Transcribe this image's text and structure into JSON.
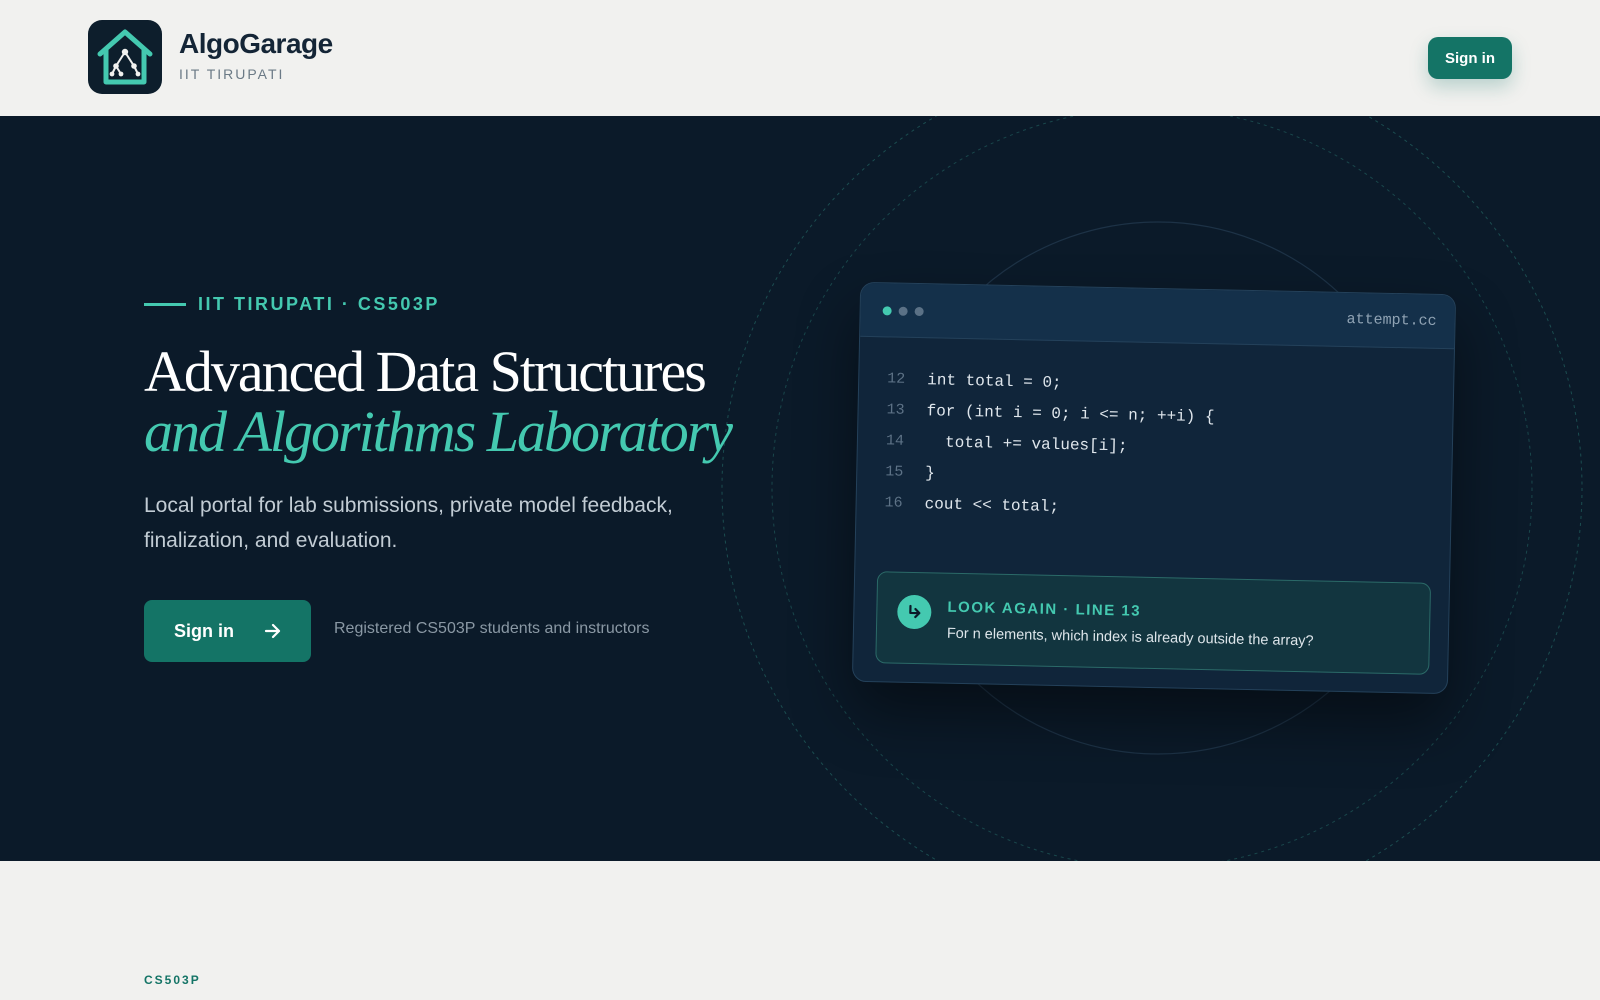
{
  "header": {
    "brand_name": "AlgoGarage",
    "brand_sub": "IIT TIRUPATI",
    "signin_label": "Sign in",
    "logo_icon": "house-tree-icon"
  },
  "hero": {
    "eyebrow": "IIT TIRUPATI · CS503P",
    "title_line1": "Advanced Data Structures",
    "title_line2": "and Algorithms Laboratory",
    "description": "Local portal for lab submissions, private model feedback, finalization, and evaluation.",
    "signin_label": "Sign in",
    "signin_icon": "arrow-right-icon",
    "note": "Registered CS503P students and instructors"
  },
  "code_card": {
    "filename": "attempt.cc",
    "lines": [
      {
        "num": "12",
        "text": "int total = 0;"
      },
      {
        "num": "13",
        "text": "for (int i = 0; i <= n; ++i) {"
      },
      {
        "num": "14",
        "text": "  total += values[i];"
      },
      {
        "num": "15",
        "text": "}"
      },
      {
        "num": "16",
        "text": "cout << total;"
      }
    ],
    "hint": {
      "icon": "return-arrow-icon",
      "title": "LOOK AGAIN · LINE 13",
      "text": "For n elements, which index is already outside the array?"
    }
  },
  "bottom": {
    "label": "CS503P"
  },
  "colors": {
    "accent": "#44c9b0",
    "primary_button": "#147466",
    "hero_bg": "#0b1a29",
    "page_bg": "#f1f1ef"
  }
}
